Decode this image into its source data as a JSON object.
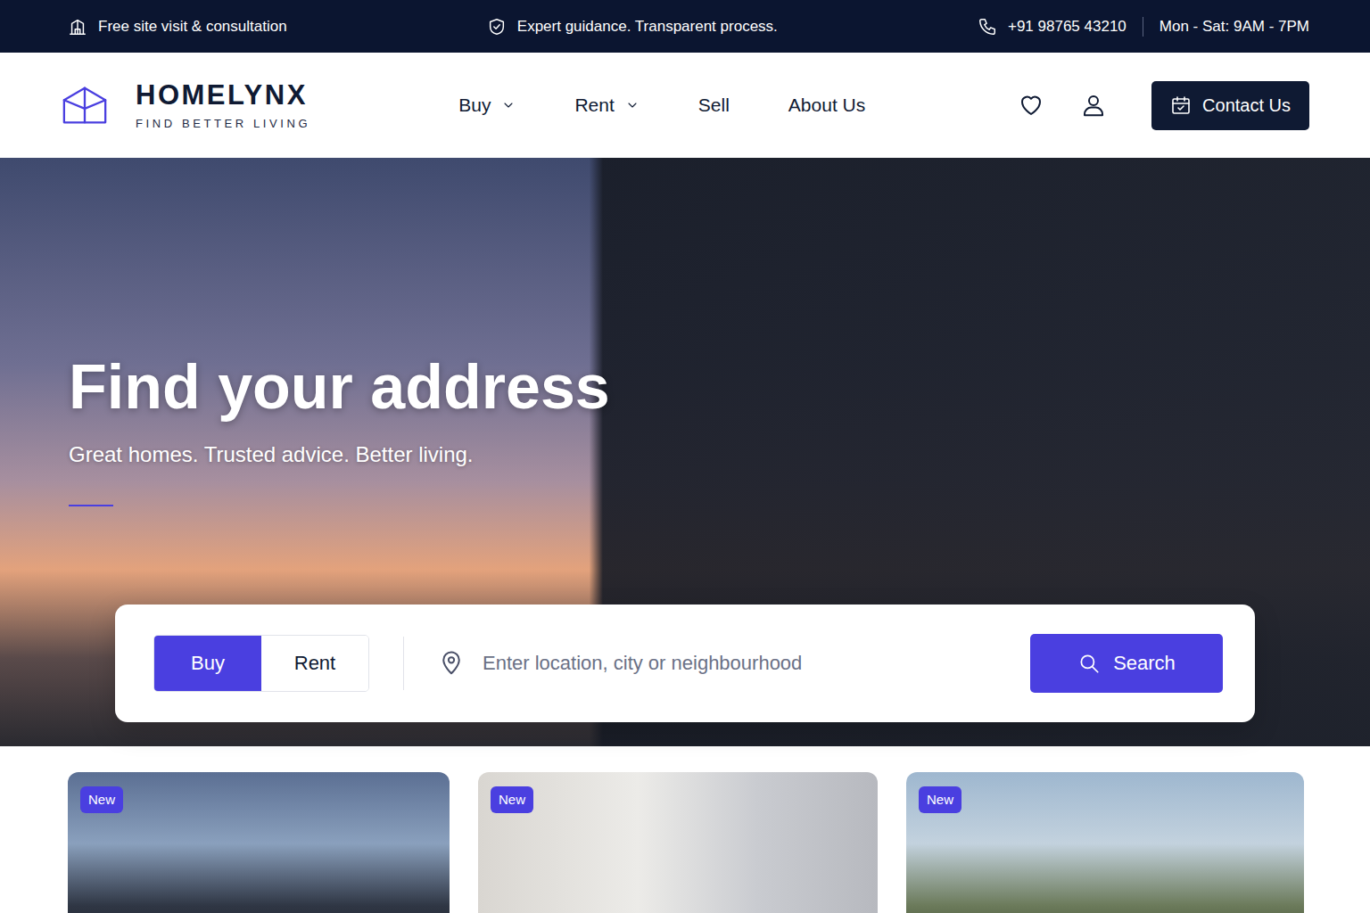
{
  "top_bar": {
    "items": [
      {
        "text": "Free site visit & consultation"
      },
      {
        "text": "Expert guidance. Transparent process."
      }
    ],
    "phone": "+91 98765 43210",
    "hours": "Mon - Sat: 9AM - 7PM"
  },
  "header": {
    "logo": {
      "name": "HOMELYNX",
      "tagline": "FIND BETTER LIVING"
    },
    "nav": [
      {
        "label": "Buy",
        "dropdown": true
      },
      {
        "label": "Rent",
        "dropdown": true
      },
      {
        "label": "Sell",
        "dropdown": false
      },
      {
        "label": "About Us",
        "dropdown": false
      }
    ],
    "contact_button": "Contact Us"
  },
  "hero": {
    "title": "Find your address",
    "subtitle": "Great homes. Trusted advice. Better living."
  },
  "search": {
    "tabs": [
      {
        "label": "Buy",
        "selected": true
      },
      {
        "label": "Rent",
        "selected": false
      }
    ],
    "placeholder": "Enter location, city or neighbourhood",
    "button": "Search"
  },
  "listings": [
    {
      "badge": "New"
    },
    {
      "badge": "New"
    },
    {
      "badge": "New"
    }
  ]
}
